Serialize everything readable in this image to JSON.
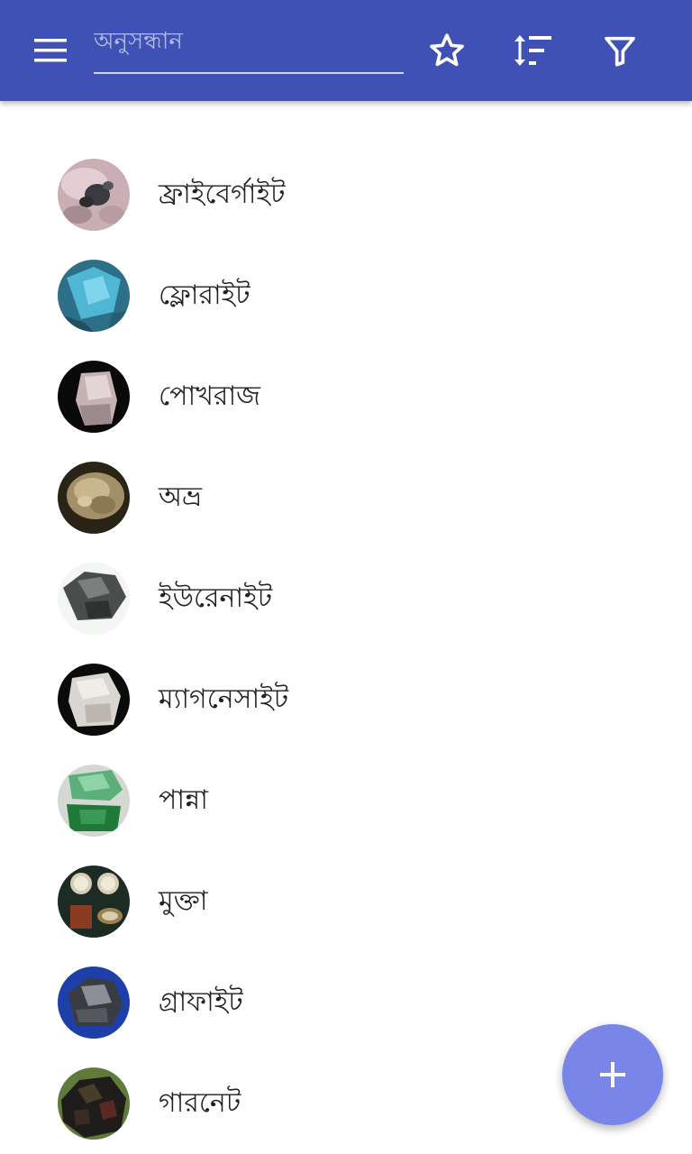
{
  "appbar": {
    "color": "#3f51b5",
    "menu_icon": "menu-icon",
    "search": {
      "placeholder": "অনুসন্ধান",
      "value": ""
    },
    "actions": [
      {
        "icon": "star-outline-icon"
      },
      {
        "icon": "sort-icon"
      },
      {
        "icon": "filter-icon"
      }
    ]
  },
  "list": {
    "items": [
      {
        "label": "ফ্রাইবের্গাইট",
        "thumbnail": "freibergite-photo"
      },
      {
        "label": "ফ্লোরাইট",
        "thumbnail": "fluorite-photo"
      },
      {
        "label": "পোখরাজ",
        "thumbnail": "topaz-photo"
      },
      {
        "label": "অভ্র",
        "thumbnail": "mica-photo"
      },
      {
        "label": "ইউরেনাইট",
        "thumbnail": "uraninite-photo"
      },
      {
        "label": "ম্যাগনেসাইট",
        "thumbnail": "magnesite-photo"
      },
      {
        "label": "পান্না",
        "thumbnail": "emerald-photo"
      },
      {
        "label": "মুক্তা",
        "thumbnail": "pearl-photo"
      },
      {
        "label": "গ্রাফাইট",
        "thumbnail": "graphite-photo"
      },
      {
        "label": "গারনেট",
        "thumbnail": "garnet-photo"
      }
    ]
  },
  "fab": {
    "icon": "plus-icon",
    "color": "#7986e8"
  }
}
